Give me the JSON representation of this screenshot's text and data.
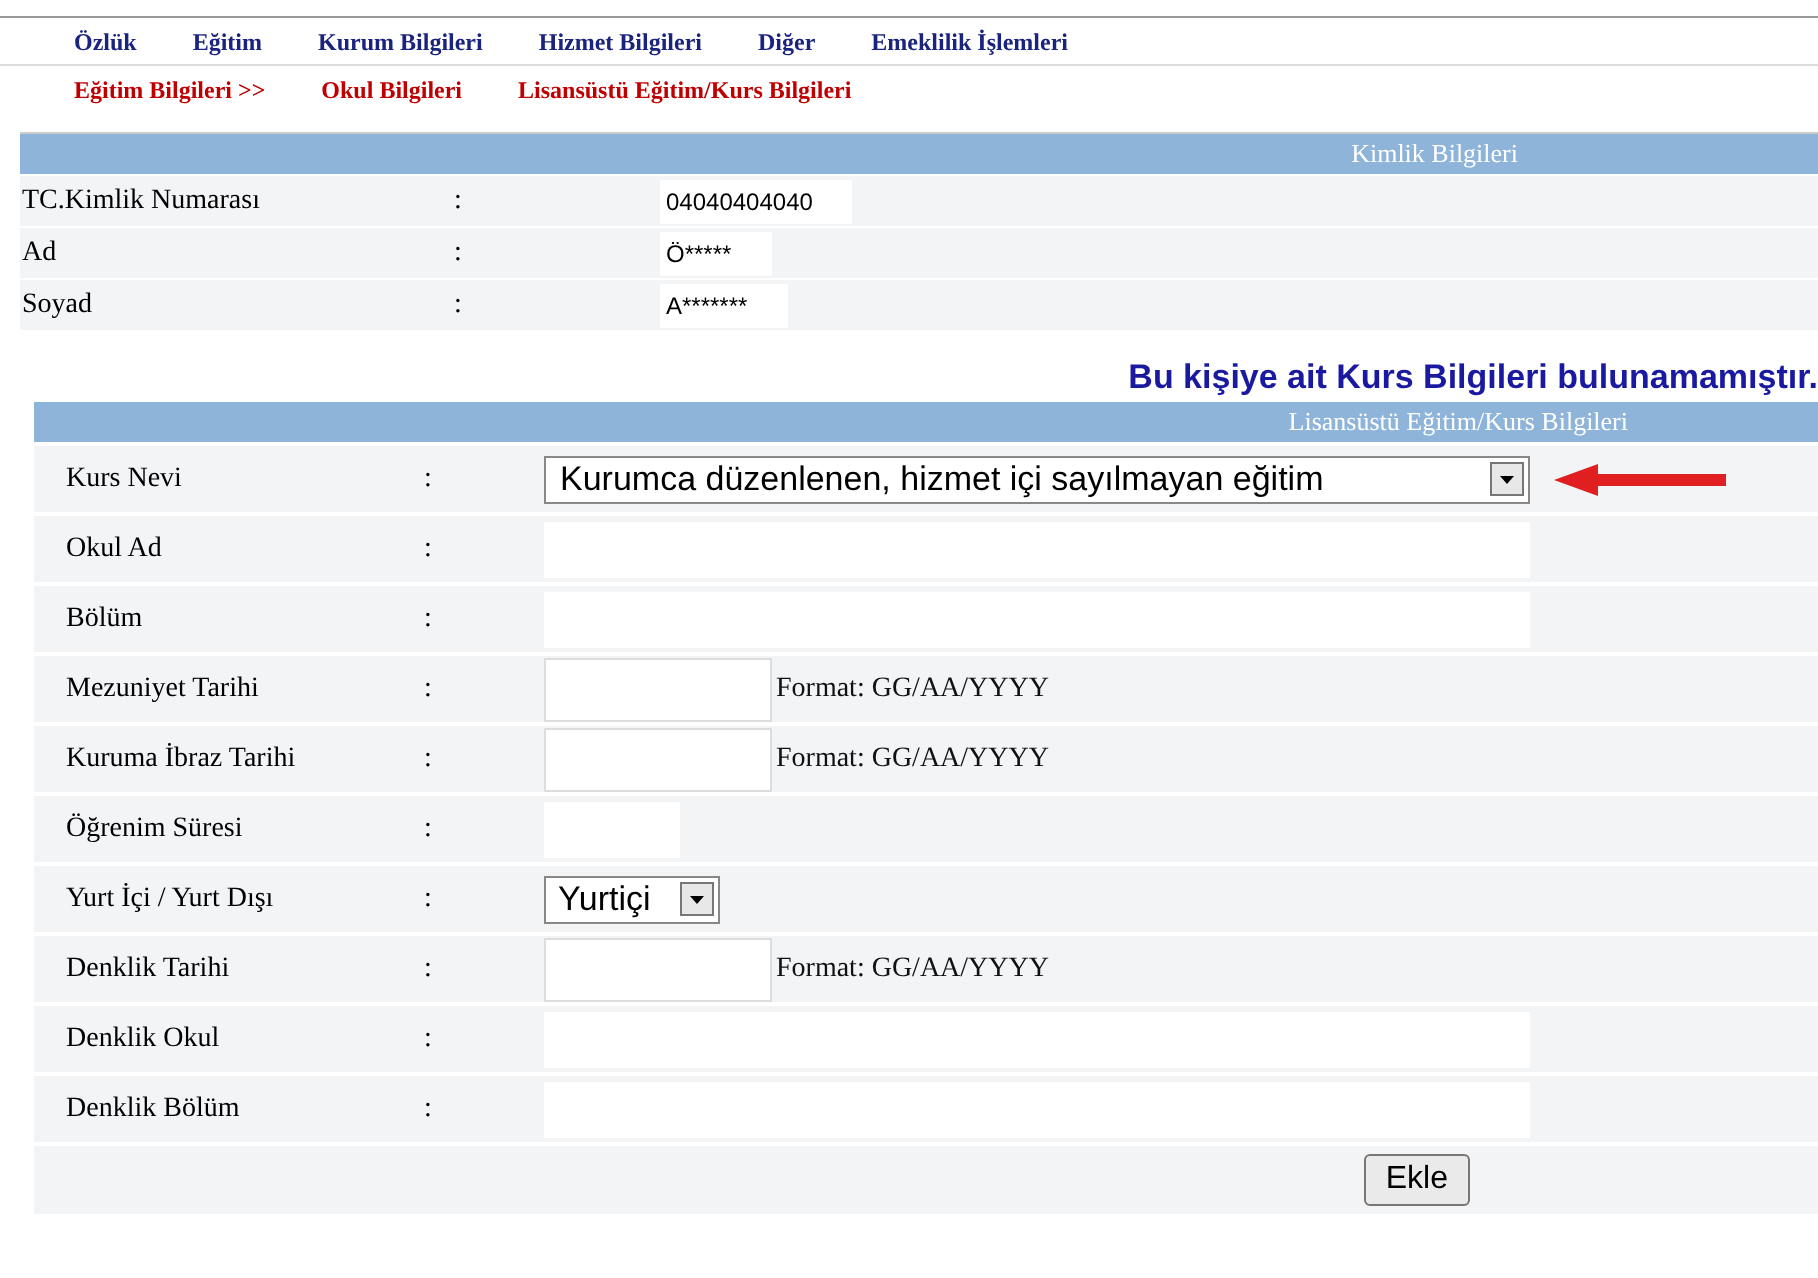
{
  "menu": [
    {
      "label": "Özlük"
    },
    {
      "label": "Eğitim"
    },
    {
      "label": "Kurum Bilgileri"
    },
    {
      "label": "Hizmet Bilgileri"
    },
    {
      "label": "Diğer"
    },
    {
      "label": "Emeklilik İşlemleri"
    }
  ],
  "submenu": [
    {
      "label": "Eğitim Bilgileri >>"
    },
    {
      "label": "Okul Bilgileri"
    },
    {
      "label": "Lisansüstü Eğitim/Kurs Bilgileri"
    }
  ],
  "identity": {
    "title": "Kimlik Bilgileri",
    "rows": [
      {
        "label": "TC.Kimlik Numarası",
        "separator": ":",
        "value": "04040404040"
      },
      {
        "label": "Ad",
        "separator": ":",
        "value": "Ö*****"
      },
      {
        "label": "Soyad",
        "separator": ":",
        "value": "A*******"
      }
    ]
  },
  "message": "Bu kişiye ait Kurs Bilgileri bulunamamıştır.",
  "form": {
    "title": "Lisansüstü Eğitim/Kurs Bilgileri",
    "rows": [
      {
        "label": "Kurs Nevi",
        "separator": ":",
        "kind": "select",
        "value": "Kurumca düzenlenen, hizmet içi sayılmayan eğitim"
      },
      {
        "label": "Okul Ad",
        "separator": ":",
        "kind": "text"
      },
      {
        "label": "Bölüm",
        "separator": ":",
        "kind": "text"
      },
      {
        "label": "Mezuniyet Tarihi",
        "separator": ":",
        "kind": "date",
        "hint": "Format: GG/AA/YYYY"
      },
      {
        "label": "Kuruma İbraz Tarihi",
        "separator": ":",
        "kind": "date",
        "hint": "Format: GG/AA/YYYY"
      },
      {
        "label": "Öğrenim Süresi",
        "separator": ":",
        "kind": "short"
      },
      {
        "label": "Yurt İçi / Yurt Dışı",
        "separator": ":",
        "kind": "select-small",
        "value": "Yurtiçi"
      },
      {
        "label": "Denklik Tarihi",
        "separator": ":",
        "kind": "date",
        "hint": "Format: GG/AA/YYYY"
      },
      {
        "label": "Denklik Okul",
        "separator": ":",
        "kind": "text"
      },
      {
        "label": "Denklik Bölüm",
        "separator": ":",
        "kind": "text"
      }
    ],
    "button": "Ekle"
  }
}
